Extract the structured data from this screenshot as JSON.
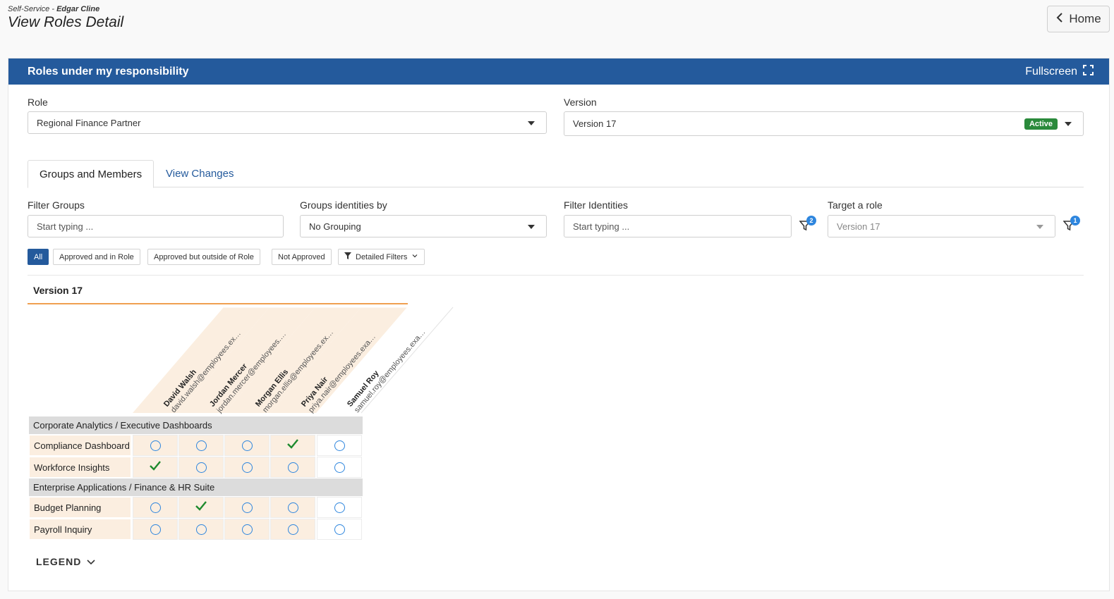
{
  "header": {
    "crumb_prefix": "Self-Service - ",
    "crumb_user": "Edgar Cline",
    "page_title": "View Roles Detail",
    "home_label": "Home"
  },
  "panel": {
    "title": "Roles under my responsibility",
    "fullscreen_label": "Fullscreen"
  },
  "role_field": {
    "label": "Role",
    "value": "Regional Finance Partner"
  },
  "version_field": {
    "label": "Version",
    "value": "Version 17",
    "status": "Active"
  },
  "tabs": [
    {
      "label": "Groups and Members",
      "active": true
    },
    {
      "label": "View Changes",
      "active": false
    }
  ],
  "filters": {
    "filter_groups": {
      "label": "Filter Groups",
      "placeholder": "Start typing ..."
    },
    "group_by": {
      "label": "Groups identities by",
      "value": "No Grouping"
    },
    "filter_identities": {
      "label": "Filter Identities",
      "placeholder": "Start typing ...",
      "count": "2"
    },
    "target_role": {
      "label": "Target a role",
      "value": "Version 17",
      "count": "1"
    }
  },
  "chips": [
    "All",
    "Approved and in Role",
    "Approved but outside of Role",
    "Not Approved",
    "Detailed Filters"
  ],
  "matrix": {
    "version_title": "Version 17",
    "identities": [
      {
        "name": "David Walsh",
        "email": "david.walsh@employees.example"
      },
      {
        "name": "Jordan Mercer",
        "email": "jordan.mercer@employees.exa..."
      },
      {
        "name": "Morgan Ellis",
        "email": "morgan.ellis@employees.exam..."
      },
      {
        "name": "Priya Nair",
        "email": "priya.nair@employees.example"
      },
      {
        "name": "Samuel Roy",
        "email": "samuel.roy@employees.example"
      }
    ],
    "groups": [
      {
        "name": "Corporate Analytics / Executive Dashboards",
        "items": [
          {
            "label": "Compliance Dashboard",
            "states": [
              "open",
              "open",
              "open",
              "check",
              "open"
            ]
          },
          {
            "label": "Workforce Insights",
            "states": [
              "check",
              "open",
              "open",
              "open",
              "open"
            ]
          }
        ]
      },
      {
        "name": "Enterprise Applications / Finance & HR Suite",
        "items": [
          {
            "label": "Budget Planning",
            "states": [
              "open",
              "check",
              "open",
              "open",
              "open"
            ]
          },
          {
            "label": "Payroll Inquiry",
            "states": [
              "open",
              "open",
              "open",
              "open",
              "open"
            ]
          }
        ]
      }
    ]
  },
  "legend_label": "LEGEND",
  "colors": {
    "brand": "#245a9c",
    "active": "#2a8a3b",
    "accent": "#f0a050",
    "circle": "#2e86de",
    "check": "#1e8a2e"
  }
}
